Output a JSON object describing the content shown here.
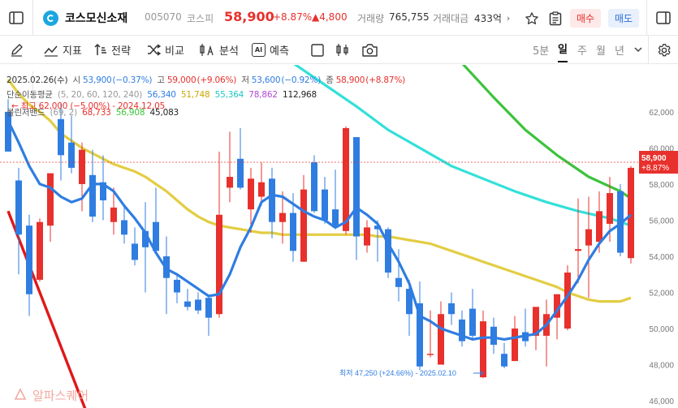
{
  "header": {
    "stock_name": "코스모신소재",
    "code": "005070",
    "market": "코스피",
    "price": "58,900",
    "change_pct": "+8.87%",
    "change_amt": "▲4,800",
    "volume_label": "거래량",
    "volume": "765,755",
    "amount_label": "거래대금",
    "amount": "433억",
    "buy_label": "매수",
    "sell_label": "매도"
  },
  "toolbar": {
    "indicator_label": "지표",
    "drawing_label": "전략",
    "compare_label": "비교",
    "analysis_label": "분석",
    "ai_icon_text": "AI",
    "predict_label": "예측",
    "timeframes": [
      "5분",
      "일",
      "주",
      "월",
      "년"
    ],
    "active_timeframe": "일"
  },
  "info": {
    "date": "2025.02.26(수)",
    "open_label": "시",
    "open": "53,900",
    "open_chg": "(−0.37%)",
    "high_label": "고",
    "high": "59,000",
    "high_chg": "(+9.06%)",
    "low_label": "저",
    "low": "53,600",
    "low_chg": "(−0.92%)",
    "close_label": "종",
    "close": "58,900",
    "close_chg": "(+8.87%)",
    "ma_label": "단순이동평균",
    "ma_params": "(5, 20, 60, 120, 240)",
    "ma_values": [
      "56,340",
      "51,748",
      "55,364",
      "78,862",
      "112,968"
    ],
    "high_note": "최고 62,000 (−5.00%) - 2024.12.05",
    "bb_label": "볼린저밴드",
    "bb_params": "(69, 2)",
    "bb_values": [
      "68,733",
      "56,908",
      "45,083"
    ]
  },
  "annotations": {
    "low_marker": "최저 47,250 (+24.66%) - 2025.02.10",
    "last_price_tag": "58,900",
    "last_change_tag": "+8.87%",
    "watermark": "알파스퀘어"
  },
  "colors": {
    "up": "#e8302c",
    "down": "#2f7de1",
    "ma5": "#2f7de1",
    "ma20": "#e3cd43",
    "ma60": "#33e0da",
    "ma120": "#3cc33c",
    "ma240": "#e01818",
    "bb_mid": "#e3cd43"
  },
  "chart_data": {
    "type": "candlestick",
    "y_axis": {
      "ticks": [
        46000,
        48000,
        50000,
        52000,
        54000,
        56000,
        58000,
        60000,
        62000
      ],
      "range": [
        45600,
        64600
      ],
      "position": "right"
    },
    "grid": false,
    "candles": [
      {
        "o": 62000,
        "h": 62700,
        "l": 59800,
        "c": 59800
      },
      {
        "o": 58200,
        "h": 58900,
        "l": 53000,
        "c": 55200
      },
      {
        "o": 55700,
        "h": 56300,
        "l": 50700,
        "c": 51900
      },
      {
        "o": 52700,
        "h": 56100,
        "l": 52600,
        "c": 55900
      },
      {
        "o": 55700,
        "h": 58400,
        "l": 54800,
        "c": 58600
      },
      {
        "o": 61600,
        "h": 62500,
        "l": 58200,
        "c": 59600
      },
      {
        "o": 60300,
        "h": 61800,
        "l": 58600,
        "c": 58900
      },
      {
        "o": 58000,
        "h": 60300,
        "l": 56500,
        "c": 59900
      },
      {
        "o": 58500,
        "h": 59900,
        "l": 55900,
        "c": 56200
      },
      {
        "o": 58100,
        "h": 59600,
        "l": 56000,
        "c": 57100
      },
      {
        "o": 55900,
        "h": 57800,
        "l": 55200,
        "c": 56700
      },
      {
        "o": 56000,
        "h": 56800,
        "l": 54700,
        "c": 55200
      },
      {
        "o": 54700,
        "h": 55600,
        "l": 53500,
        "c": 53800
      },
      {
        "o": 55400,
        "h": 57000,
        "l": 52000,
        "c": 54500
      },
      {
        "o": 55900,
        "h": 57800,
        "l": 54300,
        "c": 54300
      },
      {
        "o": 54000,
        "h": 55100,
        "l": 50800,
        "c": 52800
      },
      {
        "o": 52700,
        "h": 53000,
        "l": 51400,
        "c": 52000
      },
      {
        "o": 51500,
        "h": 52200,
        "l": 51000,
        "c": 51200
      },
      {
        "o": 51600,
        "h": 52000,
        "l": 50800,
        "c": 51000
      },
      {
        "o": 51700,
        "h": 51800,
        "l": 49600,
        "c": 50600
      },
      {
        "o": 50800,
        "h": 59800,
        "l": 50600,
        "c": 56300
      },
      {
        "o": 57800,
        "h": 60900,
        "l": 57000,
        "c": 58400
      },
      {
        "o": 59400,
        "h": 61100,
        "l": 57700,
        "c": 57800
      },
      {
        "o": 56600,
        "h": 58900,
        "l": 55300,
        "c": 58300
      },
      {
        "o": 57300,
        "h": 59200,
        "l": 56800,
        "c": 58100
      },
      {
        "o": 58300,
        "h": 58900,
        "l": 55000,
        "c": 55900
      },
      {
        "o": 55900,
        "h": 57600,
        "l": 54700,
        "c": 56400
      },
      {
        "o": 56400,
        "h": 57500,
        "l": 53700,
        "c": 54300
      },
      {
        "o": 53700,
        "h": 58500,
        "l": 53700,
        "c": 57700
      },
      {
        "o": 59200,
        "h": 59600,
        "l": 56400,
        "c": 56500
      },
      {
        "o": 57700,
        "h": 58400,
        "l": 55800,
        "c": 56000
      },
      {
        "o": 56600,
        "h": 58800,
        "l": 55500,
        "c": 55600
      },
      {
        "o": 55400,
        "h": 61200,
        "l": 55200,
        "c": 61100
      },
      {
        "o": 60600,
        "h": 60600,
        "l": 53800,
        "c": 55100
      },
      {
        "o": 54600,
        "h": 56000,
        "l": 54200,
        "c": 55600
      },
      {
        "o": 55700,
        "h": 56000,
        "l": 53700,
        "c": 55500
      },
      {
        "o": 55500,
        "h": 55600,
        "l": 52800,
        "c": 53100
      },
      {
        "o": 52800,
        "h": 54400,
        "l": 51500,
        "c": 52300
      },
      {
        "o": 52200,
        "h": 52700,
        "l": 49600,
        "c": 50800
      },
      {
        "o": 51400,
        "h": 52600,
        "l": 47700,
        "c": 47900
      },
      {
        "o": 48600,
        "h": 51000,
        "l": 48400,
        "c": 48600
      },
      {
        "o": 48000,
        "h": 51500,
        "l": 48500,
        "c": 50800
      },
      {
        "o": 51400,
        "h": 52000,
        "l": 50200,
        "c": 50800
      },
      {
        "o": 50500,
        "h": 51000,
        "l": 49000,
        "c": 49300
      },
      {
        "o": 51100,
        "h": 52200,
        "l": 49400,
        "c": 49600
      },
      {
        "o": 47300,
        "h": 51000,
        "l": 47250,
        "c": 50400
      },
      {
        "o": 50100,
        "h": 50600,
        "l": 48600,
        "c": 49100
      },
      {
        "o": 48600,
        "h": 49200,
        "l": 47800,
        "c": 47900
      },
      {
        "o": 48200,
        "h": 50700,
        "l": 48200,
        "c": 50000
      },
      {
        "o": 49800,
        "h": 51100,
        "l": 49000,
        "c": 49300
      },
      {
        "o": 49600,
        "h": 51000,
        "l": 48800,
        "c": 51200
      },
      {
        "o": 49600,
        "h": 51600,
        "l": 47900,
        "c": 50800
      },
      {
        "o": 50600,
        "h": 51900,
        "l": 49400,
        "c": 51900
      },
      {
        "o": 50000,
        "h": 53500,
        "l": 49900,
        "c": 53100
      },
      {
        "o": 54300,
        "h": 57200,
        "l": 52500,
        "c": 54400
      },
      {
        "o": 54600,
        "h": 57300,
        "l": 51700,
        "c": 55500
      },
      {
        "o": 54800,
        "h": 57600,
        "l": 54200,
        "c": 56500
      },
      {
        "o": 55800,
        "h": 58400,
        "l": 54800,
        "c": 57500
      },
      {
        "o": 57600,
        "h": 58000,
        "l": 54000,
        "c": 54200
      },
      {
        "o": 53900,
        "h": 59000,
        "l": 53600,
        "c": 58900
      }
    ],
    "ma5": [
      61500,
      60300,
      59000,
      58000,
      57800,
      57300,
      57000,
      57200,
      58000,
      58000,
      57600,
      56800,
      56100,
      55300,
      54200,
      53300,
      53000,
      52600,
      52200,
      51800,
      51900,
      53000,
      54500,
      55600,
      57000,
      57400,
      57300,
      56900,
      56500,
      56200,
      56000,
      55600,
      55900,
      56700,
      56300,
      55800,
      54700,
      53700,
      52500,
      50700,
      50400,
      50000,
      49800,
      49600,
      49400,
      49500,
      49500,
      49400,
      49500,
      49600,
      49700,
      50200,
      51000,
      51800,
      52700,
      53800,
      54700,
      55400,
      55800,
      56300
    ],
    "ma20": [
      63800,
      63000,
      62400,
      62000,
      61500,
      60800,
      60400,
      60000,
      59700,
      59400,
      59100,
      58900,
      58700,
      58400,
      58000,
      57600,
      57100,
      56600,
      56200,
      55900,
      55700,
      55600,
      55500,
      55400,
      55300,
      55300,
      55200,
      55200,
      55200,
      55200,
      55200,
      55200,
      55200,
      55200,
      55200,
      55100,
      55100,
      55000,
      54900,
      54800,
      54700,
      54500,
      54300,
      54100,
      53900,
      53700,
      53500,
      53300,
      53100,
      52900,
      52700,
      52500,
      52300,
      52000,
      51800,
      51600,
      51500,
      51500,
      51500,
      51700
    ],
    "ma60": [
      [
        27,
        64700
      ],
      [
        30,
        63500
      ],
      [
        33,
        62300
      ],
      [
        36,
        61000
      ],
      [
        39,
        60000
      ],
      [
        42,
        59000
      ],
      [
        45,
        58300
      ],
      [
        48,
        57600
      ],
      [
        51,
        57000
      ],
      [
        54,
        56500
      ],
      [
        57,
        56100
      ],
      [
        59,
        55700
      ]
    ],
    "ma120": [
      [
        43,
        64700
      ],
      [
        46,
        62800
      ],
      [
        49,
        61000
      ],
      [
        52,
        59600
      ],
      [
        55,
        58400
      ],
      [
        58,
        57600
      ],
      [
        59,
        57200
      ]
    ],
    "ma240": [
      [
        0,
        56500
      ],
      [
        2,
        53500
      ],
      [
        4,
        50500
      ],
      [
        6,
        47500
      ],
      [
        8,
        44500
      ]
    ]
  }
}
